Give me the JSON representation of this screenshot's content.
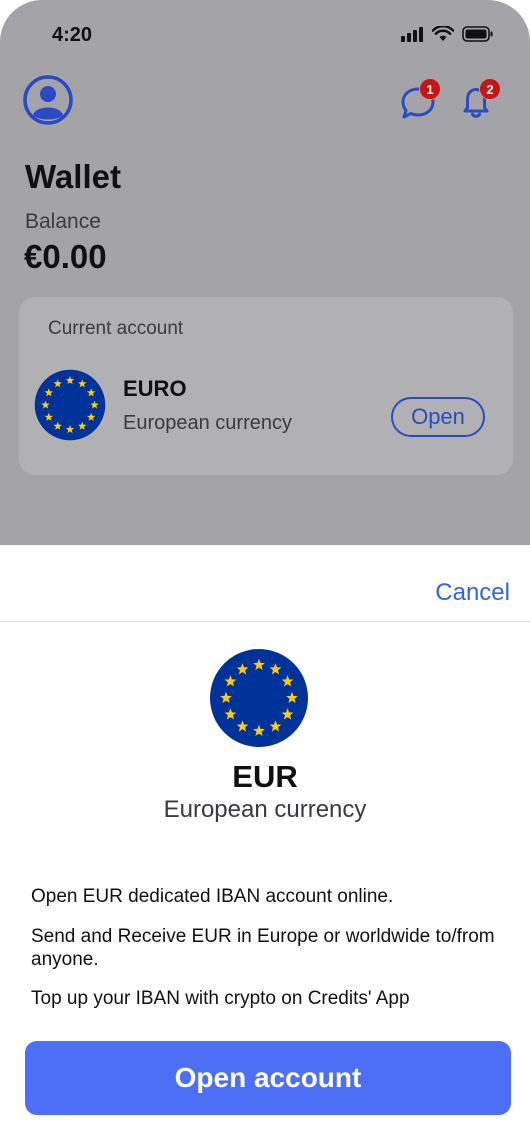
{
  "status_bar": {
    "time": "4:20"
  },
  "header": {
    "messages_badge": "1",
    "notifications_badge": "2"
  },
  "wallet": {
    "title": "Wallet",
    "balance_label": "Balance",
    "balance_value": "€0.00"
  },
  "account_card": {
    "label": "Current account",
    "currency_name": "EURO",
    "currency_desc": "European currency",
    "open_label": "Open"
  },
  "sheet": {
    "cancel_label": "Cancel",
    "currency_code": "EUR",
    "currency_desc": "European currency",
    "info_lines": [
      "Open EUR dedicated IBAN account online.",
      "Send and Receive EUR in Europe or worldwide to/from anyone.",
      "Top up your IBAN with crypto on Credits' App"
    ],
    "cta_label": "Open account"
  },
  "colors": {
    "accent": "#4d6ff5",
    "link": "#3366dd",
    "badge": "#c81414",
    "eu_blue": "#003399",
    "eu_star": "#ffcc00"
  },
  "icons": [
    "user-avatar-icon",
    "chat-bubble-icon",
    "bell-icon",
    "eu-flag-icon",
    "signal-icon",
    "wifi-icon",
    "battery-icon"
  ]
}
